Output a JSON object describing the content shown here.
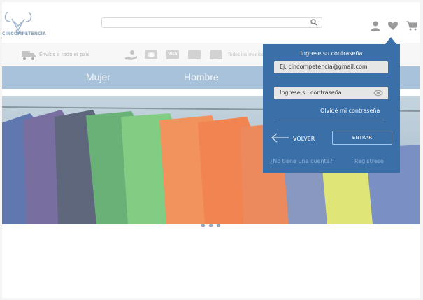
{
  "header": {
    "logo_text": "CINCOMPETENCIA",
    "search_placeholder": ""
  },
  "infobar": {
    "shipping": "Envíos a todo el país",
    "cards": [
      "",
      "VISA",
      "",
      ""
    ],
    "payment_text": "Todos los medios de pago"
  },
  "nav": {
    "items": [
      "Mujer",
      "Hombre"
    ]
  },
  "carousel": {
    "slide_count": 3
  },
  "login": {
    "title": "Ingrese su contraseña",
    "email_value": "Ej. cincompetencia@gmail.com",
    "password_placeholder": "Ingrese su contraseña",
    "forgot": "Olvidé mi contraseña",
    "back": "VOLVER",
    "enter": "ENTRAR",
    "no_account": "¿No tiene una cuenta?",
    "register": "Regístrese"
  },
  "colors": {
    "modal": "#3a6fa8",
    "nav": "#a8c2dc"
  }
}
